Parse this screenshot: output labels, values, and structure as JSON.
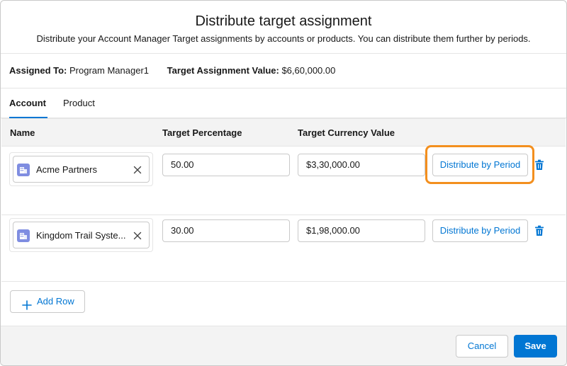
{
  "modal": {
    "title": "Distribute target assignment",
    "subtitle": "Distribute your Account Manager Target assignments by accounts or products. You can distribute them further by periods."
  },
  "assignment": {
    "assigned_to_label": "Assigned To:",
    "assigned_to_value": "Program Manager1",
    "value_label": "Target Assignment Value:",
    "value_value": "$6,60,000.00"
  },
  "tabs": [
    {
      "label": "Account",
      "active": true
    },
    {
      "label": "Product",
      "active": false
    }
  ],
  "table": {
    "headers": [
      "Name",
      "Target Percentage",
      "Target Currency Value"
    ],
    "rows": [
      {
        "name": "Acme Partners",
        "percentage": "50.00",
        "currency": "$3,30,000.00",
        "action": "Distribute by Period",
        "highlighted": true
      },
      {
        "name": "Kingdom Trail Systems",
        "name_display": "Kingdom Trail Syste...",
        "percentage": "30.00",
        "currency": "$1,98,000.00",
        "action": "Distribute by Period",
        "highlighted": false
      }
    ]
  },
  "add_row_label": "Add Row",
  "footer": {
    "cancel_label": "Cancel",
    "save_label": "Save"
  },
  "icons": {
    "account": "account-icon",
    "remove": "close-icon",
    "delete": "trash-icon",
    "add": "plus-icon"
  },
  "colors": {
    "brand": "#0176d3",
    "highlight": "#f38f1e",
    "account_icon": "#7f8de1"
  }
}
